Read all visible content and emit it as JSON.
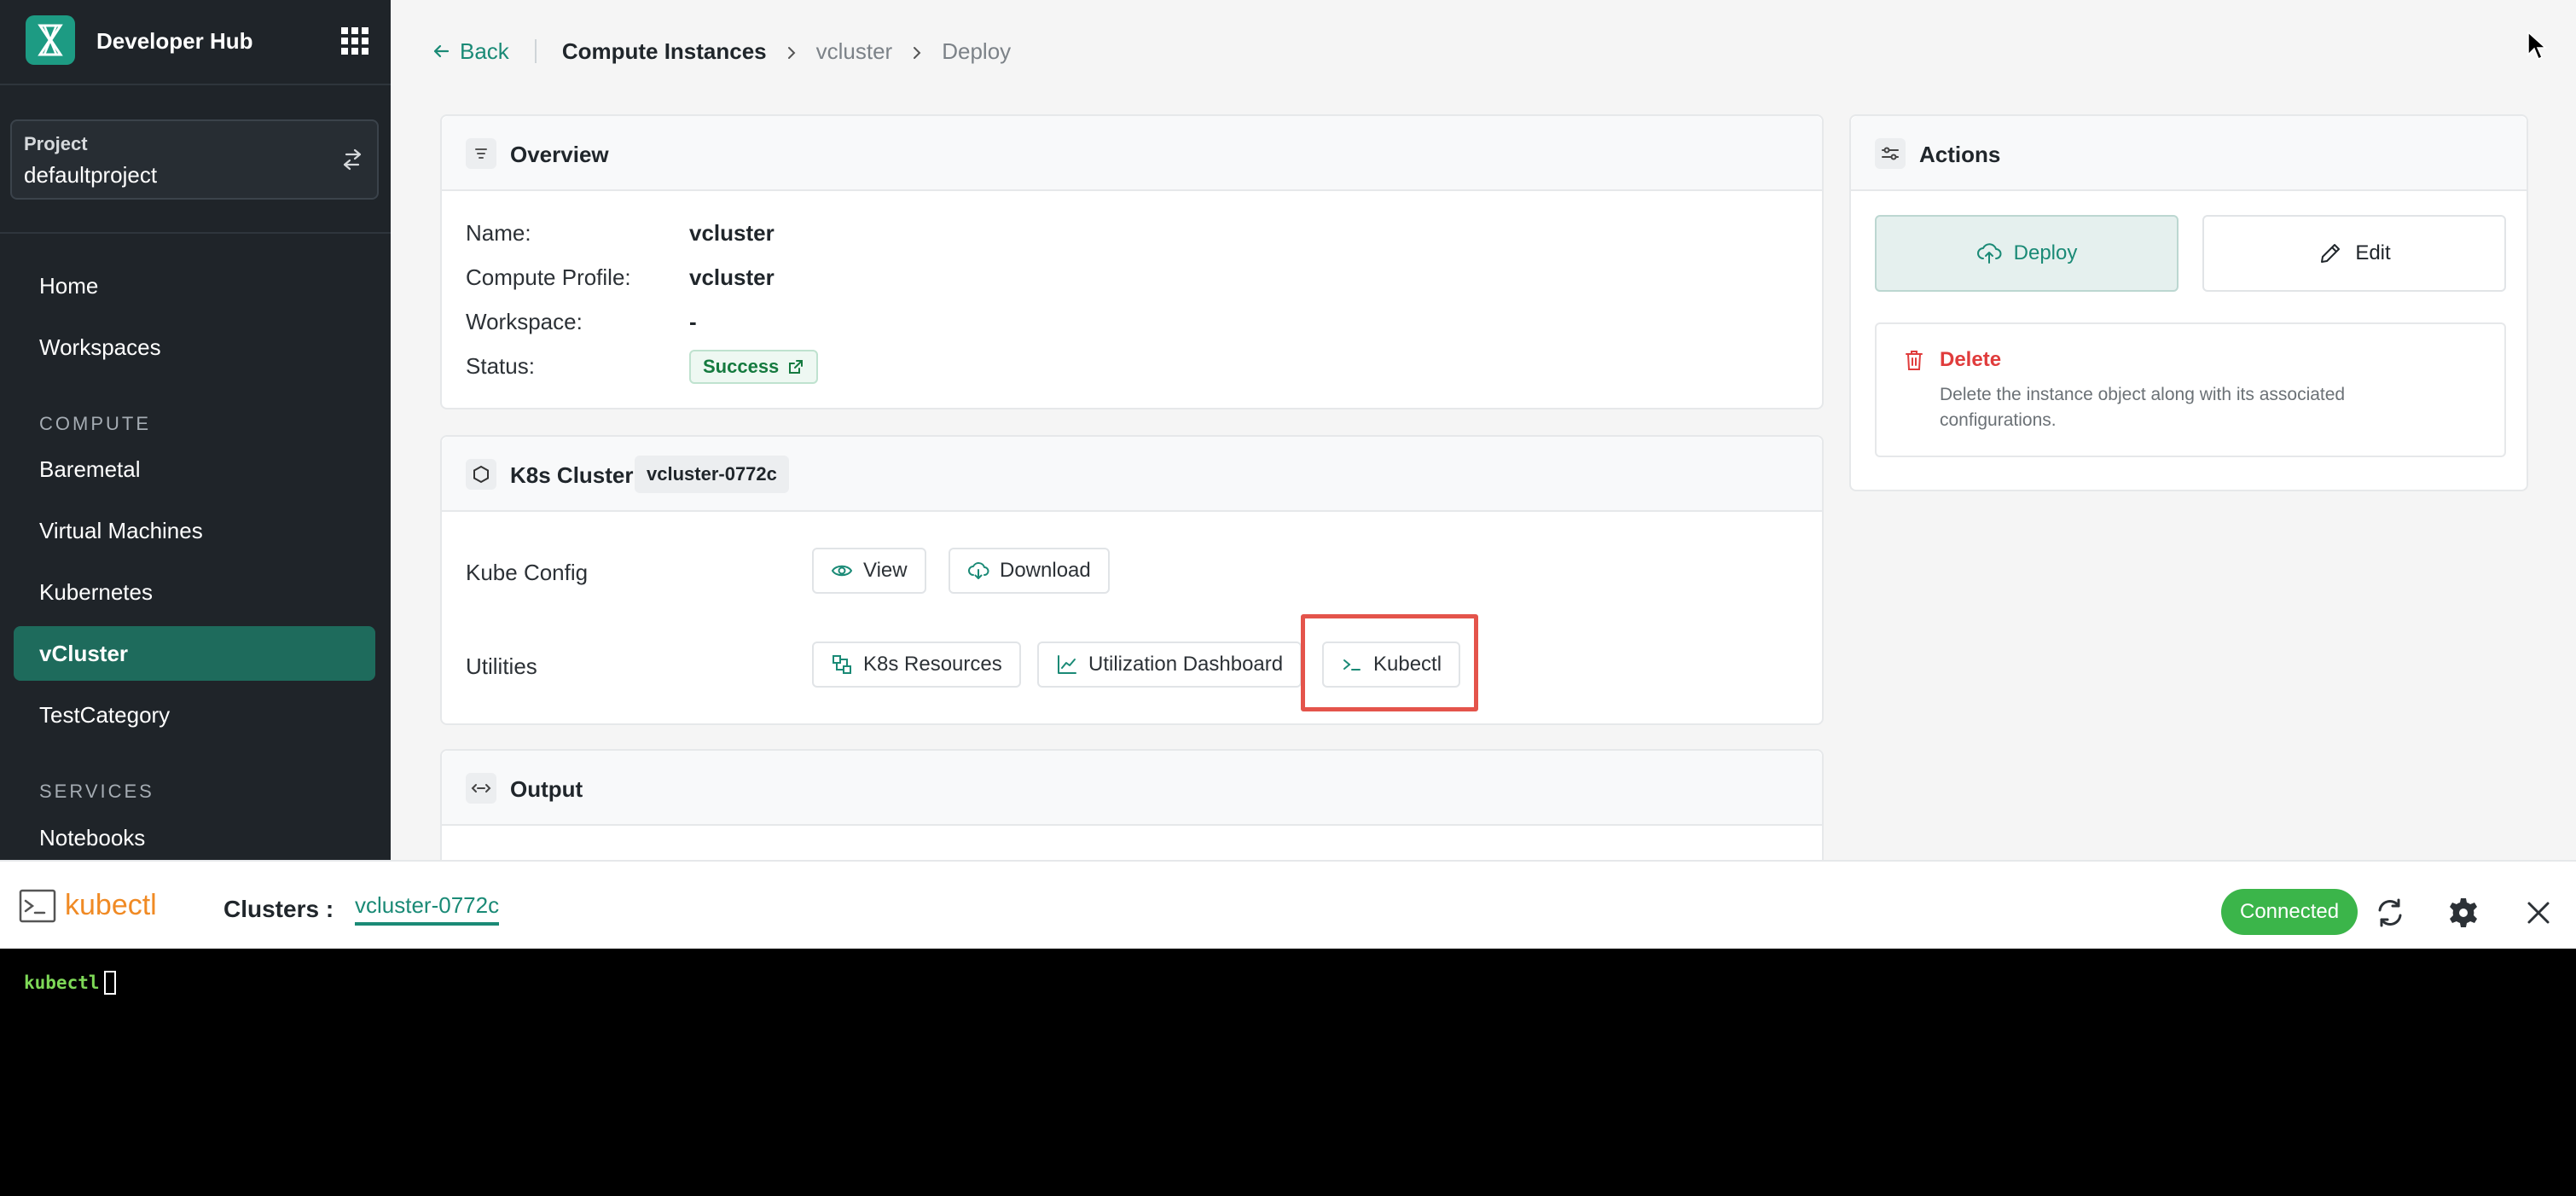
{
  "sidebar": {
    "app_name": "Developer Hub",
    "project": {
      "label": "Project",
      "value": "defaultproject"
    },
    "items_top": [
      {
        "label": "Home"
      },
      {
        "label": "Workspaces"
      }
    ],
    "compute_section": "COMPUTE",
    "compute_items": [
      {
        "label": "Baremetal"
      },
      {
        "label": "Virtual Machines"
      },
      {
        "label": "Kubernetes"
      },
      {
        "label": "vCluster"
      },
      {
        "label": "TestCategory"
      }
    ],
    "services_section": "SERVICES",
    "services_items": [
      {
        "label": "Notebooks"
      }
    ],
    "active_item": "vCluster"
  },
  "breadcrumb": {
    "back": "Back",
    "items": [
      "Compute Instances",
      "vcluster",
      "Deploy"
    ]
  },
  "overview": {
    "title": "Overview",
    "fields": [
      {
        "label": "Name:",
        "value": "vcluster"
      },
      {
        "label": "Compute Profile:",
        "value": "vcluster"
      },
      {
        "label": "Workspace:",
        "value": "-"
      },
      {
        "label": "Status:",
        "value": "Success"
      }
    ]
  },
  "k8s": {
    "title": "K8s Cluster",
    "cluster_tag": "vcluster-0772c",
    "kube_config_label": "Kube Config",
    "view_label": "View",
    "download_label": "Download",
    "utilities_label": "Utilities",
    "k8s_resources_label": "K8s Resources",
    "utilization_label": "Utilization Dashboard",
    "kubectl_label": "Kubectl"
  },
  "output": {
    "title": "Output"
  },
  "actions": {
    "title": "Actions",
    "deploy_label": "Deploy",
    "edit_label": "Edit",
    "delete_title": "Delete",
    "delete_desc": "Delete the instance object along with its associated configurations."
  },
  "terminal": {
    "brand": "kubectl",
    "clusters_label": "Clusters :",
    "active_cluster": "vcluster-0772c",
    "status": "Connected",
    "prompt": "kubectl"
  },
  "colors": {
    "accent": "#1a8a76",
    "sidebar_bg": "#1f2429",
    "active_nav": "#1e6b5c",
    "highlight": "#e4544b",
    "connected": "#3bb54a",
    "brand_orange": "#f08a24",
    "danger": "#e03c3c"
  }
}
